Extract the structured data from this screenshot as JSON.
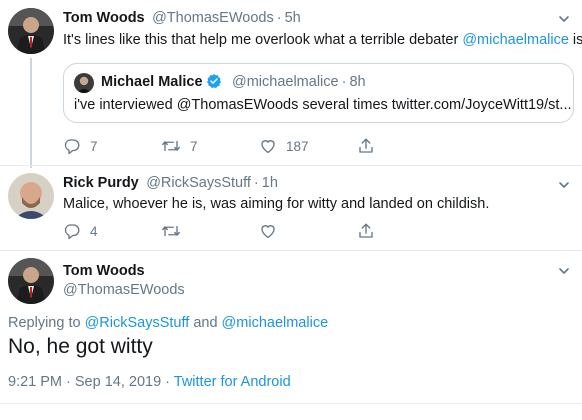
{
  "tweet1": {
    "name": "Tom Woods",
    "handle": "@ThomasEWoods",
    "time": "5h",
    "text_before": "It's lines like this that help me overlook what a terrible debater ",
    "mention": "@michaelmalice",
    "text_after": " is",
    "quote": {
      "name": "Michael Malice",
      "handle": "@michaelmalice",
      "time": "8h",
      "text": "i've interviewed @ThomasEWoods several times twitter.com/JoyceWitt19/st..."
    },
    "replies": "7",
    "retweets": "7",
    "likes": "187"
  },
  "tweet2": {
    "name": "Rick Purdy",
    "handle": "@RickSaysStuff",
    "time": "1h",
    "text": "Malice, whoever he is, was aiming for witty and landed on childish.",
    "replies": "4",
    "retweets": "",
    "likes": ""
  },
  "tweet3": {
    "name": "Tom Woods",
    "handle": "@ThomasEWoods",
    "replying_prefix": "Replying to ",
    "replying_user1": "@RickSaysStuff",
    "replying_and": " and ",
    "replying_user2": "@michaelmalice",
    "text": "No, he got witty",
    "timestamp": "9:21 PM · Sep 14, 2019 · ",
    "source": "Twitter for Android"
  },
  "colors": {
    "link": "#1b95e0",
    "secondary": "#657786",
    "border": "#ccd6dd"
  },
  "icons": [
    "reply-icon",
    "retweet-icon",
    "like-icon",
    "share-icon",
    "chevron-down-icon",
    "verified-icon"
  ]
}
